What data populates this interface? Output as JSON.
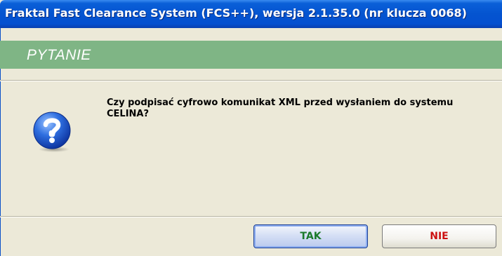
{
  "window": {
    "title": "Fraktal Fast Clearance System (FCS++), wersja 2.1.35.0 (nr klucza 0068)"
  },
  "header": {
    "label": "PYTANIE"
  },
  "dialog": {
    "icon": "question-icon",
    "message": "Czy podpisać cyfrowo komunikat XML przed wysłaniem do systemu CELINA?"
  },
  "buttons": {
    "yes_label": "TAK",
    "no_label": "NIE"
  },
  "colors": {
    "titlebar": "#0454d0",
    "header_band": "#7fb585",
    "yes_text": "#1a7a2a",
    "no_text": "#cc1111"
  }
}
